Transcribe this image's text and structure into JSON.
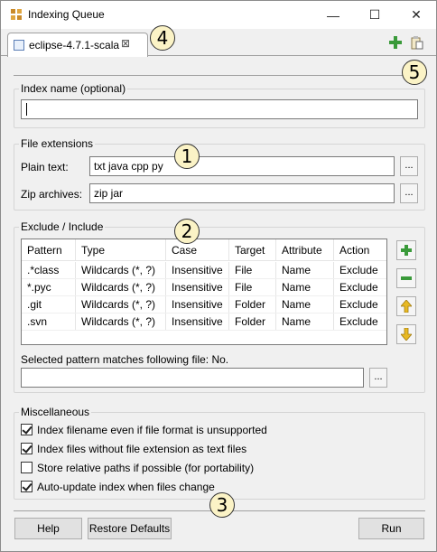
{
  "window": {
    "title": "Indexing Queue",
    "minimize": "—",
    "maximize": "☐",
    "close": "✕"
  },
  "tab": {
    "label": "eclipse-4.7.1-scala",
    "close": "⊠"
  },
  "toolbar": {
    "add_icon": "add-icon",
    "paste_icon": "clipboard-icon"
  },
  "index_name": {
    "group_title": "Index name (optional)",
    "value": ""
  },
  "file_extensions": {
    "group_title": "File extensions",
    "plain_label": "Plain text:",
    "plain_value": "txt java cpp py",
    "zip_label": "Zip archives:",
    "zip_value": "zip jar",
    "browse": "..."
  },
  "exclude_include": {
    "group_title": "Exclude / Include",
    "columns": [
      "Pattern",
      "Type",
      "Case",
      "Target",
      "Attribute",
      "Action"
    ],
    "rows": [
      [
        ".*class",
        "Wildcards (*, ?)",
        "Insensitive",
        "File",
        "Name",
        "Exclude"
      ],
      [
        "*.pyc",
        "Wildcards (*, ?)",
        "Insensitive",
        "File",
        "Name",
        "Exclude"
      ],
      [
        ".git",
        "Wildcards (*, ?)",
        "Insensitive",
        "Folder",
        "Name",
        "Exclude"
      ],
      [
        ".svn",
        "Wildcards (*, ?)",
        "Insensitive",
        "Folder",
        "Name",
        "Exclude"
      ]
    ],
    "match_label": "Selected pattern matches following file: No.",
    "match_value": "",
    "browse": "..."
  },
  "misc": {
    "group_title": "Miscellaneous",
    "options": [
      {
        "label": "Index filename even if file format is unsupported",
        "checked": true
      },
      {
        "label": "Index files without file extension as text files",
        "checked": true
      },
      {
        "label": "Store relative paths if possible (for portability)",
        "checked": false
      },
      {
        "label": "Auto-update index when files change",
        "checked": true
      }
    ]
  },
  "buttons": {
    "help": "Help",
    "restore": "Restore Defaults",
    "run": "Run"
  },
  "badges": [
    "1",
    "2",
    "3",
    "4",
    "5"
  ],
  "colors": {
    "add_green": "#3a9a3a",
    "remove_green": "#3a9a3a",
    "arrow_yellow": "#e8b923",
    "badge_fill": "#fbf3c6"
  }
}
